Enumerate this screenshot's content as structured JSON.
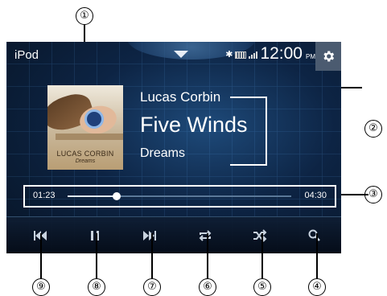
{
  "callouts": [
    "①",
    "②",
    "③",
    "④",
    "⑤",
    "⑥",
    "⑦",
    "⑧",
    "⑨"
  ],
  "header": {
    "source_label": "iPod",
    "clock": "12:00",
    "ampm": "PM"
  },
  "track": {
    "artist": "Lucas Corbin",
    "title": "Five Winds",
    "album": "Dreams"
  },
  "cover_art": {
    "artist_text": "LUCAS CORBIN",
    "title_text": "Dreams"
  },
  "progress": {
    "elapsed": "01:23",
    "total": "04:30",
    "fraction": 0.22
  },
  "controls": [
    {
      "name": "previous-button",
      "icon": "skip-previous-icon"
    },
    {
      "name": "pause-button",
      "icon": "pause-icon"
    },
    {
      "name": "next-button",
      "icon": "skip-next-icon"
    },
    {
      "name": "repeat-button",
      "icon": "repeat-icon"
    },
    {
      "name": "shuffle-button",
      "icon": "shuffle-icon"
    },
    {
      "name": "search-button",
      "icon": "search-icon"
    }
  ],
  "colors": {
    "screen_bg": "#0d2444",
    "text": "#ffffff",
    "icon": "#c9d3df",
    "settings_bg": "#4b5b70"
  }
}
